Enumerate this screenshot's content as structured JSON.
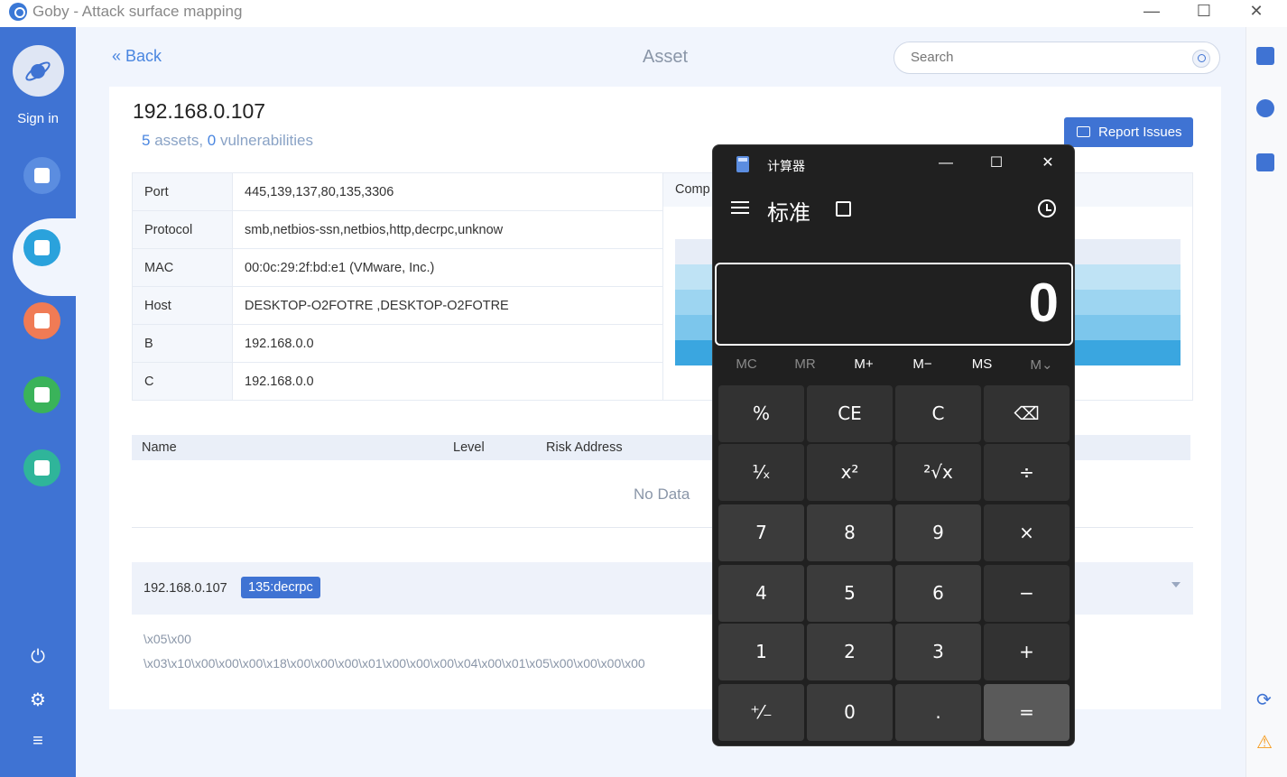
{
  "window": {
    "title": "Goby - Attack surface mapping",
    "minimize": "—",
    "maximize": "☐",
    "close": "✕"
  },
  "sidebar": {
    "sign_in": "Sign in",
    "items": [
      {
        "name": "scan",
        "color": "#5b8de0"
      },
      {
        "name": "asset",
        "color": "#2aa2dc"
      },
      {
        "name": "vulnerability",
        "color": "#f07b55"
      },
      {
        "name": "report",
        "color": "#3ab35a"
      },
      {
        "name": "plugin",
        "color": "#2fb59a"
      }
    ]
  },
  "header": {
    "back": "« Back",
    "title": "Asset",
    "search_placeholder": "Search"
  },
  "asset": {
    "ip": "192.168.0.107",
    "assets_count": "5",
    "assets_text": " assets, ",
    "vuln_count": "0",
    "vuln_text": " vulnerabilities",
    "report_button": "Report Issues",
    "info": [
      {
        "key": "Port",
        "value": "445,139,137,80,135,3306"
      },
      {
        "key": "Protocol",
        "value": "smb,netbios-ssn,netbios,http,decrpc,unknow"
      },
      {
        "key": "MAC",
        "value": "00:0c:29:2f:bd:e1 (VMware, Inc.)"
      },
      {
        "key": "Host",
        "value": "DESKTOP-O2FOTRE ,DESKTOP-O2FOTRE"
      },
      {
        "key": "B",
        "value": "192.168.0.0"
      },
      {
        "key": "C",
        "value": "192.168.0.0"
      }
    ],
    "components_header": "Comp",
    "vuln_table": {
      "columns": [
        "Name",
        "Level",
        "Risk Address"
      ],
      "empty": "No Data"
    },
    "port_row": {
      "ip": "192.168.0.107",
      "tag": "135:decrpc",
      "banner_line1": "\\x05\\x00",
      "banner_line2": "\\x03\\x10\\x00\\x00\\x00\\x18\\x00\\x00\\x00\\x01\\x00\\x00\\x00\\x04\\x00\\x01\\x05\\x00\\x00\\x00\\x00"
    }
  },
  "calculator": {
    "title": "计算器",
    "mode": "标准",
    "display": "0",
    "memory": [
      "MC",
      "MR",
      "M+",
      "M−",
      "MS",
      "M⌄"
    ],
    "keys": [
      [
        "%",
        "CE",
        "C",
        "⌫"
      ],
      [
        "¹⁄ₓ",
        "x²",
        "²√x",
        "÷"
      ],
      [
        "7",
        "8",
        "9",
        "×"
      ],
      [
        "4",
        "5",
        "6",
        "−"
      ],
      [
        "1",
        "2",
        "3",
        "+"
      ],
      [
        "⁺⁄₋",
        "0",
        ".",
        "="
      ]
    ]
  }
}
